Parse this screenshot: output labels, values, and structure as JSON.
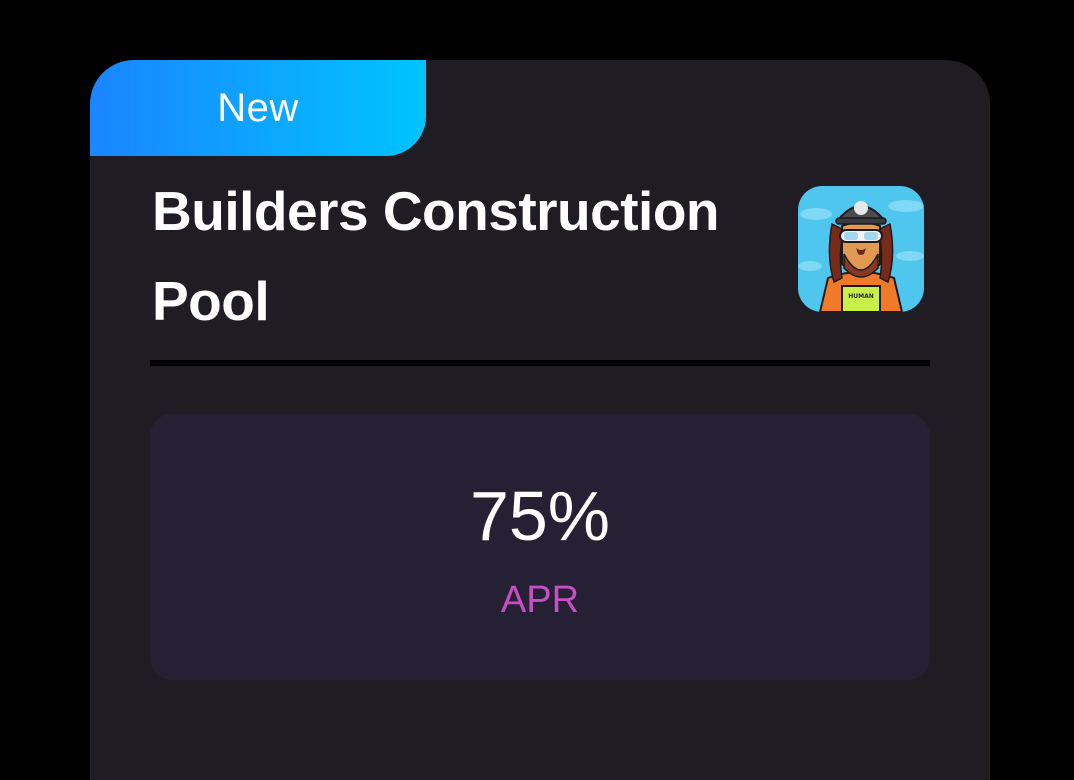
{
  "pool_card": {
    "badge_label": "New",
    "title": "Builders Construction Pool",
    "avatar_icon": "lion-nft-avatar-icon",
    "apr": {
      "value": "75%",
      "label": "APR"
    },
    "colors": {
      "background": "#000000",
      "card": "#1f1c23",
      "stat_box": "#252033",
      "badge_gradient_start": "#1a85ff",
      "badge_gradient_end": "#00c4ff",
      "apr_label": "#c64fc6"
    }
  }
}
